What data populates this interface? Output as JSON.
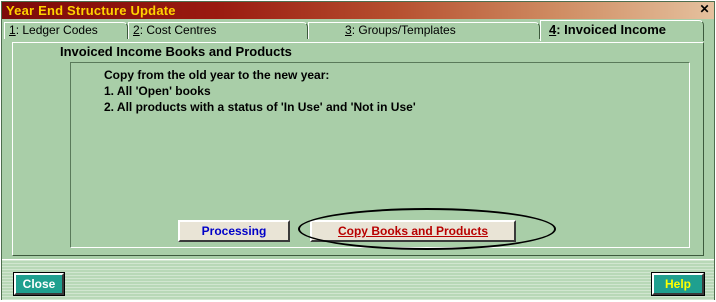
{
  "window": {
    "title": "Year End Structure Update",
    "close_glyph": "✕"
  },
  "tabs": [
    {
      "key": "1",
      "rest": ": Ledger Codes",
      "active": false
    },
    {
      "key": "2",
      "rest": ": Cost Centres",
      "active": false
    },
    {
      "key": "3",
      "rest": ": Groups/Templates",
      "active": false
    },
    {
      "key": "4",
      "rest": ": Invoiced Income",
      "active": true
    }
  ],
  "panel": {
    "heading": "Invoiced Income Books and Products",
    "lines": [
      "Copy from the old year to the new year:",
      "1. All 'Open' books",
      "2. All products with a status of 'In Use' and 'Not in Use'"
    ]
  },
  "buttons": {
    "processing": "Processing",
    "copy": "Copy Books and Products",
    "close": "Close",
    "help": "Help"
  },
  "colors": {
    "background": "#a9cea8",
    "title_text": "#ffd200",
    "processing_text": "#0000c8",
    "copy_text": "#b80000",
    "nav_button": "#1fa08f"
  }
}
